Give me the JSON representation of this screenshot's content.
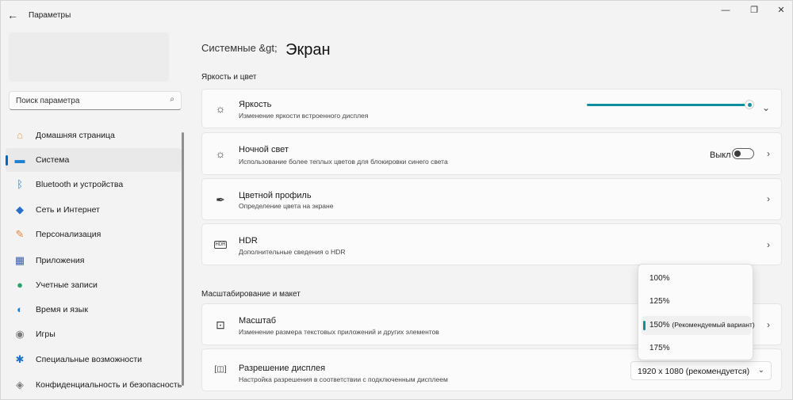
{
  "window": {
    "title": "Параметры",
    "back_icon": "←",
    "minimize_icon": "—",
    "maximize_icon": "❐",
    "close_icon": "✕"
  },
  "sidebar": {
    "search": {
      "placeholder": "Поиск параметра",
      "icon": "⌕"
    },
    "items": [
      {
        "label": "Домашняя страница",
        "icon": "home-icon",
        "glyph": "⌂",
        "color": "#e8a04a",
        "active": false
      },
      {
        "label": "Система",
        "icon": "display-icon",
        "glyph": "▬",
        "color": "#1f7fd1",
        "active": true
      },
      {
        "label": "Bluetooth и устройства",
        "icon": "bluetooth-icon",
        "glyph": "ᛒ",
        "color": "#1f7fd1",
        "active": false
      },
      {
        "label": "Сеть и Интернет",
        "icon": "wifi-icon",
        "glyph": "◆",
        "color": "#2a6fc9",
        "active": false
      },
      {
        "label": "Персонализация",
        "icon": "brush-icon",
        "glyph": "✎",
        "color": "#e08a3c",
        "active": false
      },
      {
        "label": "Приложения",
        "icon": "apps-icon",
        "glyph": "▦",
        "color": "#3b5fa8",
        "active": false
      },
      {
        "label": "Учетные записи",
        "icon": "account-icon",
        "glyph": "●",
        "color": "#2aa36b",
        "active": false
      },
      {
        "label": "Время и язык",
        "icon": "globe-clock-icon",
        "glyph": "◐",
        "color": "#1f7fd1",
        "active": false
      },
      {
        "label": "Игры",
        "icon": "gamepad-icon",
        "glyph": "◉",
        "color": "#7a7a7a",
        "active": false
      },
      {
        "label": "Специальные возможности",
        "icon": "accessibility-icon",
        "glyph": "✱",
        "color": "#1f6fc4",
        "active": false
      },
      {
        "label": "Конфиденциальность и безопасность",
        "icon": "shield-icon",
        "glyph": "◈",
        "color": "#7c7c7c",
        "active": false
      }
    ]
  },
  "main": {
    "breadcrumb": {
      "parent": "Системные &gt;",
      "current": "Экран"
    },
    "sections": {
      "brightness_color": "Яркость и цвет",
      "scale_layout": "Масштабирование и макет"
    },
    "cards": {
      "brightness": {
        "title": "Яркость",
        "subtitle": "Изменение яркости встроенного дисплея",
        "icon": "☼",
        "value": 1.0
      },
      "night_light": {
        "title": "Ночной свет",
        "subtitle": "Использование более теплых цветов для блокировки синего света",
        "icon": "☼",
        "state_label": "Выкл",
        "on": false
      },
      "color_profile": {
        "title": "Цветной профиль",
        "subtitle": "Определение цвета на экране",
        "icon": "✒"
      },
      "hdr": {
        "title": "HDR",
        "subtitle": "Дополнительные сведения о HDR",
        "icon": "HDR"
      },
      "scale": {
        "title": "Масштаб",
        "subtitle": "Изменение размера текстовых приложений и других элементов",
        "icon": "⊡"
      },
      "resolution": {
        "title": "Разрешение дисплея",
        "subtitle": "Настройка разрешения в соответствии с подключенным дисплеем",
        "icon": "[◫]",
        "value": "1920 x 1080 (рекомендуется)"
      }
    },
    "scale_dropdown": {
      "options": [
        {
          "label": "100%",
          "note": ""
        },
        {
          "label": "125%",
          "note": ""
        },
        {
          "label": "150%",
          "note": "(Рекомендуемый вариант)"
        },
        {
          "label": "175%",
          "note": ""
        }
      ],
      "selected_index": 2
    },
    "chevron_right": "›",
    "chevron_down": "⌄"
  },
  "colors": {
    "accent": "#0f8f9e",
    "nav_accent": "#0067c0"
  }
}
